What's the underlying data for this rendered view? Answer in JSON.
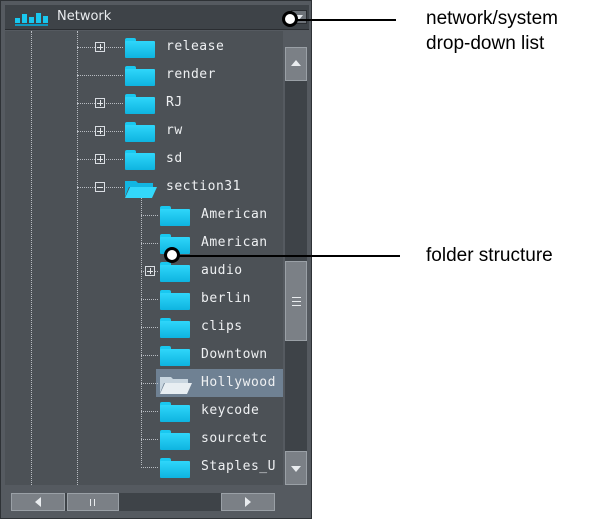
{
  "header": {
    "title": "Network",
    "logo_icon": "network-logo-icon",
    "dropdown_icon": "dropdown-icon"
  },
  "tree": {
    "items": [
      {
        "label": "release",
        "level": 1,
        "expander": "plus"
      },
      {
        "label": "render",
        "level": 1,
        "expander": "none"
      },
      {
        "label": "RJ",
        "level": 1,
        "expander": "plus"
      },
      {
        "label": "rw",
        "level": 1,
        "expander": "plus"
      },
      {
        "label": "sd",
        "level": 1,
        "expander": "plus"
      },
      {
        "label": "section31",
        "level": 1,
        "expander": "minus",
        "open": true
      },
      {
        "label": "American",
        "level": 2,
        "expander": "none"
      },
      {
        "label": "American",
        "level": 2,
        "expander": "none"
      },
      {
        "label": "audio",
        "level": 2,
        "expander": "plus"
      },
      {
        "label": "berlin",
        "level": 2,
        "expander": "none"
      },
      {
        "label": "clips",
        "level": 2,
        "expander": "none"
      },
      {
        "label": "Downtown",
        "level": 2,
        "expander": "none"
      },
      {
        "label": "Hollywood",
        "level": 2,
        "expander": "none",
        "selected": true,
        "open": true
      },
      {
        "label": "keycode",
        "level": 2,
        "expander": "none"
      },
      {
        "label": "sourcetc",
        "level": 2,
        "expander": "none"
      },
      {
        "label": "Staples_U",
        "level": 2,
        "expander": "none"
      }
    ]
  },
  "callouts": {
    "dropdown": {
      "line1": "network/system",
      "line2": "drop-down list"
    },
    "folders": {
      "text": "folder structure"
    }
  },
  "colors": {
    "panel": "#555a60",
    "tree_background": "#4c5156",
    "folder": "#19c8f0",
    "selection": "#6f8193"
  }
}
